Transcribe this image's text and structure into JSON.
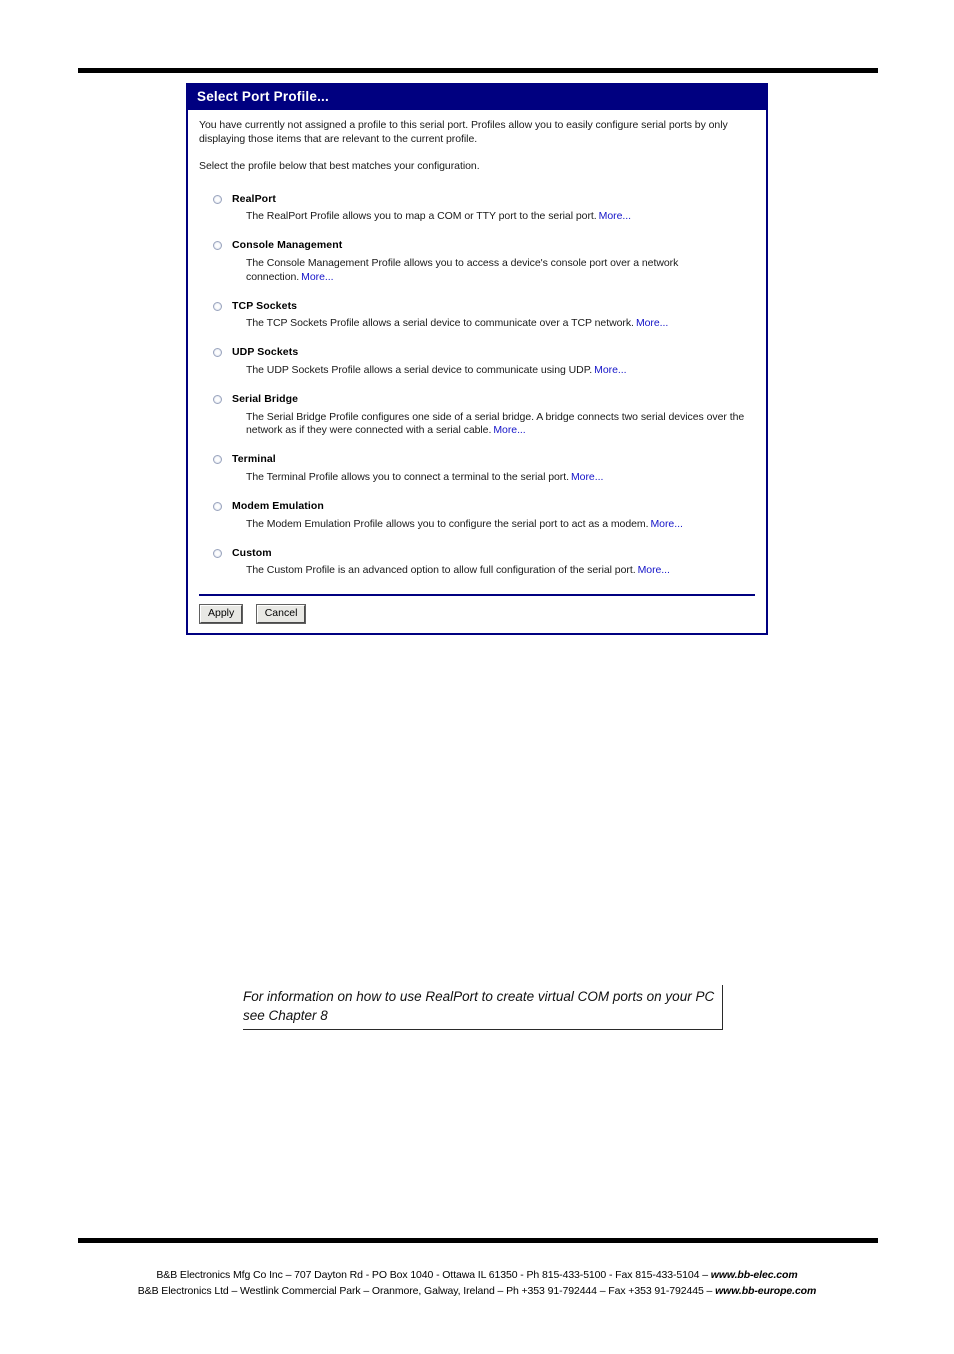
{
  "dialog": {
    "title": "Select Port Profile...",
    "intro_paragraph_1": "You have currently not assigned a profile to this serial port. Profiles allow you to easily configure serial ports by only displaying those items that are relevant to the current profile.",
    "intro_paragraph_2": "Select the profile below that best matches your configuration.",
    "options": [
      {
        "name": "RealPort",
        "description": "The RealPort Profile allows you to map a COM or TTY port to the serial port.",
        "more_label": "More...",
        "selected": false
      },
      {
        "name": "Console Management",
        "description": "The Console Management Profile allows you to access a device's console port over a network connection.",
        "more_label": "More...",
        "selected": false
      },
      {
        "name": "TCP Sockets",
        "description": "The TCP Sockets Profile allows a serial device to communicate over a TCP network.",
        "more_label": "More...",
        "selected": false
      },
      {
        "name": "UDP Sockets",
        "description": "The UDP Sockets Profile allows a serial device to communicate using UDP.",
        "more_label": "More...",
        "selected": false
      },
      {
        "name": "Serial Bridge",
        "description": "The Serial Bridge Profile configures one side of a serial bridge. A bridge connects two serial devices over the network as if they were connected with a serial cable.",
        "more_label": "More...",
        "selected": false
      },
      {
        "name": "Terminal",
        "description": "The Terminal Profile allows you to connect a terminal to the serial port.",
        "more_label": "More...",
        "selected": false
      },
      {
        "name": "Modem Emulation",
        "description": "The Modem Emulation Profile allows you to configure the serial port to act as a modem.",
        "more_label": "More...",
        "selected": false
      },
      {
        "name": "Custom",
        "description": "The Custom Profile is an advanced option to allow full configuration of the serial port.",
        "more_label": "More...",
        "selected": false
      }
    ],
    "apply_label": "Apply",
    "cancel_label": "Cancel",
    "colors": {
      "titlebar": "#000080",
      "border": "#000080",
      "link": "#1414c8"
    }
  },
  "note": {
    "text": "For information on how to use RealPort to create virtual COM ports on your PC see Chapter 8"
  },
  "footer": {
    "line1_text": "B&B Electronics Mfg Co Inc – 707 Dayton Rd - PO Box 1040 - Ottawa IL 61350 - Ph 815-433-5100 - Fax 815-433-5104 – ",
    "line1_site": "www.bb-elec.com",
    "line2_text": "B&B Electronics Ltd – Westlink Commercial Park – Oranmore, Galway, Ireland – Ph +353 91-792444 – Fax +353 91-792445 – ",
    "line2_site": "www.bb-europe.com"
  }
}
